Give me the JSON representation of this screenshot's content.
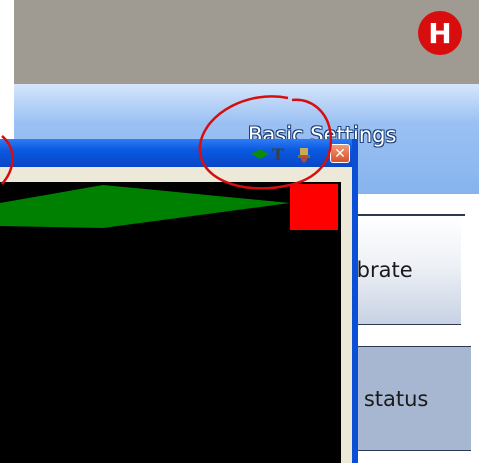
{
  "settings_window": {
    "title": "Basic Settings",
    "buttons": {
      "calibrate_label": "librate",
      "status_label": "k status"
    }
  },
  "overlay_window": {
    "toolbar_icons": [
      "diamond-icon",
      "text-tool-icon",
      "pin-icon"
    ],
    "t_glyph": "T",
    "close_glyph": "✕",
    "canvas_background": "#000000",
    "shapes": [
      {
        "kind": "diamond",
        "color": "#008000"
      },
      {
        "kind": "square",
        "color": "#ff0000"
      }
    ]
  },
  "annotation": {
    "badge_letter": "H",
    "color": "#d80e0e"
  },
  "colors": {
    "header_blue": "#86b3ee",
    "titlebar_blue": "#0a59e0",
    "frame_beige": "#ece9d8",
    "gray_strip": "#9f9b93"
  }
}
